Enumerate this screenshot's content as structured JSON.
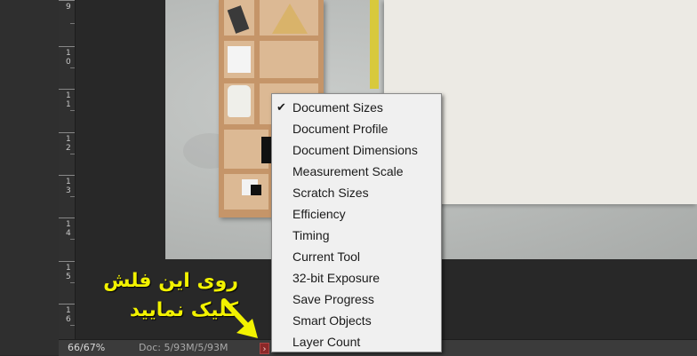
{
  "ruler": {
    "labels": [
      "9",
      "10",
      "11",
      "12",
      "13",
      "14",
      "15",
      "16"
    ]
  },
  "annotation": {
    "line1": "روی این فلش",
    "line2": "کلیک نمایید"
  },
  "statusbar": {
    "zoom": "66/67%",
    "doc_info": "Doc: 5/93M/5/93M",
    "arrow": "›"
  },
  "menu": {
    "items": [
      {
        "label": "Document Sizes",
        "checked": true
      },
      {
        "label": "Document Profile",
        "checked": false
      },
      {
        "label": "Document Dimensions",
        "checked": false
      },
      {
        "label": "Measurement Scale",
        "checked": false
      },
      {
        "label": "Scratch Sizes",
        "checked": false
      },
      {
        "label": "Efficiency",
        "checked": false
      },
      {
        "label": "Timing",
        "checked": false
      },
      {
        "label": "Current Tool",
        "checked": false
      },
      {
        "label": "32-bit Exposure",
        "checked": false
      },
      {
        "label": "Save Progress",
        "checked": false
      },
      {
        "label": "Smart Objects",
        "checked": false
      },
      {
        "label": "Layer Count",
        "checked": false
      }
    ],
    "check_glyph": "✔"
  },
  "colors": {
    "annotation": "#f2f200",
    "menu_bg": "#f0f0f0",
    "canvas_bg": "#282828"
  }
}
